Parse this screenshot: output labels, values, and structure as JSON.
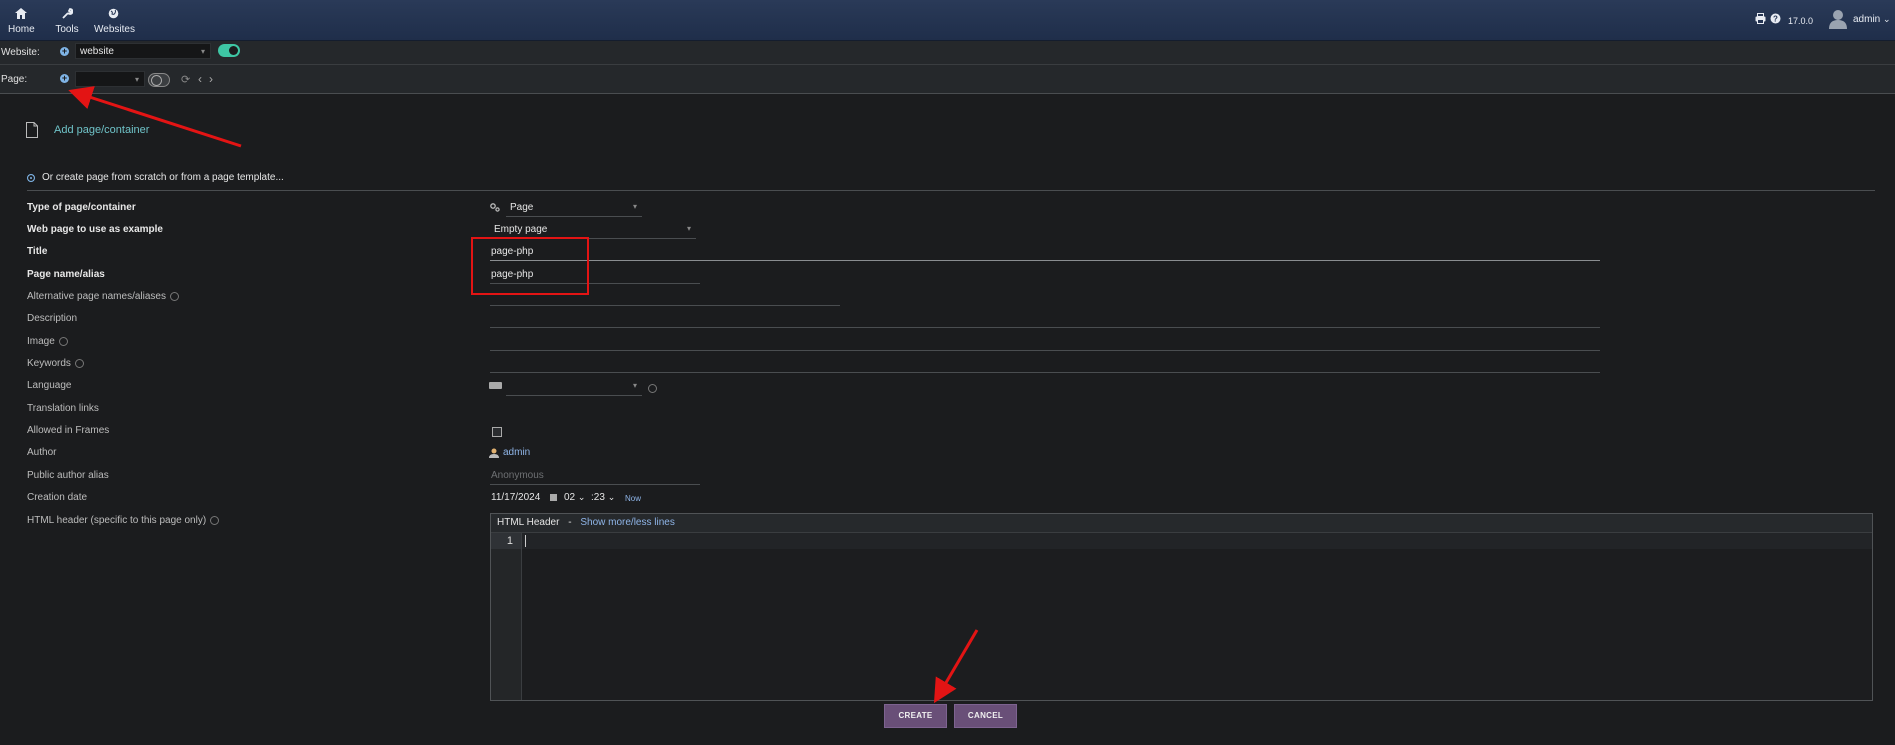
{
  "nav": {
    "home": "Home",
    "tools": "Tools",
    "websites": "Websites"
  },
  "topright": {
    "version": "17.0.0",
    "user": "admin"
  },
  "website_bar": {
    "label": "Website:",
    "selected": "website",
    "enabled": true
  },
  "page_bar": {
    "label": "Page:",
    "selected": "",
    "enabled": false
  },
  "add_page": {
    "label": "Add page/container"
  },
  "create_option": {
    "label": "Or create page from scratch or from a page template..."
  },
  "form": {
    "type_label": "Type of page/container",
    "type_value": "Page",
    "example_label": "Web page to use as example",
    "example_value": "Empty page",
    "title_label": "Title",
    "title_value": "page-php",
    "alias_label": "Page name/alias",
    "alias_value": "page-php",
    "alt_alias_label": "Alternative page names/aliases",
    "description_label": "Description",
    "image_label": "Image",
    "keywords_label": "Keywords",
    "language_label": "Language",
    "translation_label": "Translation links",
    "frames_label": "Allowed in Frames",
    "author_label": "Author",
    "author_value": "admin",
    "public_alias_label": "Public author alias",
    "public_alias_placeholder": "Anonymous",
    "creation_label": "Creation date",
    "creation_date": "11/17/2024",
    "creation_hour": "02",
    "creation_minute": ":23",
    "now_label": "Now",
    "html_header_label": "HTML header (specific to this page only)"
  },
  "editor": {
    "title": "HTML Header",
    "separator": "-",
    "toggle_link": "Show more/less lines",
    "line_number": "1"
  },
  "buttons": {
    "create": "CREATE",
    "cancel": "CANCEL"
  },
  "colors": {
    "topbar": "#233352",
    "accent_toggle": "#3ec6a4",
    "button": "#694f78",
    "link": "#8fb5e8",
    "annotation": "#e31414"
  }
}
